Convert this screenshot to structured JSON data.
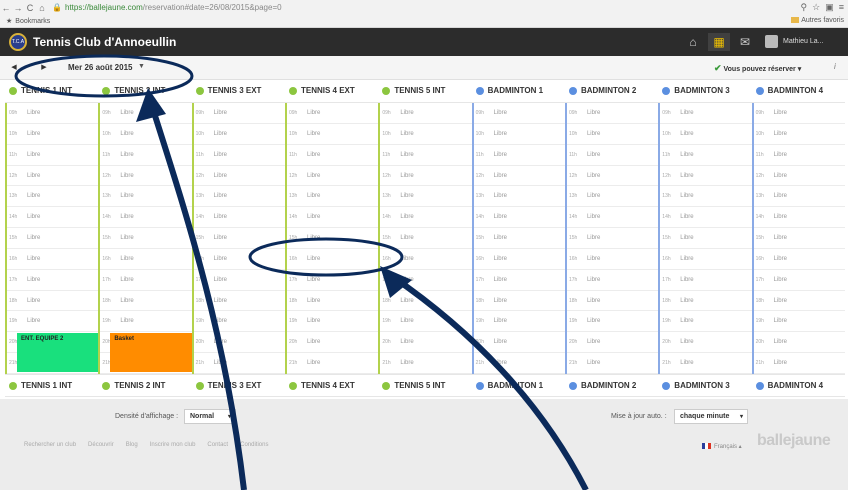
{
  "browser": {
    "url_domain": "https://ballejaune.com",
    "url_path": "/reservation#date=26/08/2015&page=0",
    "bookmarks_label": "Bookmarks",
    "other_bookmarks_label": "Autres favoris"
  },
  "header": {
    "logo_text": "T.C.A",
    "title": "Tennis Club d'Annoeullin",
    "user_name": "Mathieu La..."
  },
  "date_bar": {
    "date_label": "Mer 26 août 2015",
    "status_label": "Vous pouvez réserver"
  },
  "colors": {
    "tennis": "#8cc63f",
    "badminton": "#5b8fe0",
    "ent_equipe_block": "#19e07d",
    "basket_block": "#ff8c00"
  },
  "courts": [
    {
      "name": "TENNIS 1 INT",
      "type": "tennis"
    },
    {
      "name": "TENNIS 2 INT",
      "type": "tennis"
    },
    {
      "name": "TENNIS 3 EXT",
      "type": "tennis"
    },
    {
      "name": "TENNIS 4 EXT",
      "type": "tennis"
    },
    {
      "name": "TENNIS 5 INT",
      "type": "tennis"
    },
    {
      "name": "BADMINTON 1",
      "type": "badminton"
    },
    {
      "name": "BADMINTON 2",
      "type": "badminton"
    },
    {
      "name": "BADMINTON 3",
      "type": "badminton"
    },
    {
      "name": "BADMINTON 4",
      "type": "badminton"
    }
  ],
  "hours": [
    "09h",
    "10h",
    "11h",
    "12h",
    "13h",
    "14h",
    "15h",
    "16h",
    "17h",
    "18h",
    "19h",
    "20h",
    "21h"
  ],
  "free_label": "Libre",
  "reservations": [
    {
      "court": 0,
      "hour": 11,
      "label": "ENT. EQUIPE 2",
      "color": "#19e07d"
    },
    {
      "court": 1,
      "hour": 11,
      "label": "Basket",
      "color": "#ff8c00"
    }
  ],
  "footer": {
    "density_label": "Densité d'affichage :",
    "density_value": "Normal",
    "update_label": "Mise à jour auto. :",
    "update_value": "chaque minute",
    "links": [
      "Rechercher un club",
      "Découvrir",
      "Blog",
      "Inscrire mon club",
      "Contact",
      "Conditions"
    ],
    "language": "Français",
    "brand": "ballejaune"
  }
}
